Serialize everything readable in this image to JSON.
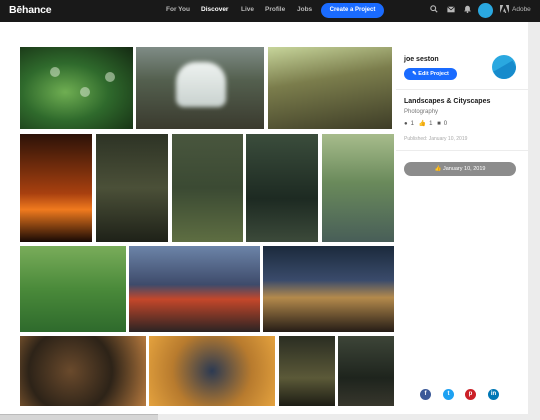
{
  "brand": {
    "logo": "Bēhance"
  },
  "nav": {
    "links": [
      "For You",
      "Discover",
      "Live",
      "Profile",
      "Jobs"
    ],
    "active": "Discover",
    "create_label": "Create a Project",
    "icons": [
      "search-icon",
      "mail-icon",
      "bell-icon"
    ],
    "adobe_label": "Adobe"
  },
  "sidebar": {
    "owner_name": "joe seston",
    "edit_label": "Edit Project",
    "project_title": "Landscapes & Cityscapes",
    "field": "Photography",
    "stats": {
      "views": "1",
      "appreciations": "1",
      "comments": "0"
    },
    "published": "Published: January 10, 2019",
    "appreciate_date": "January 10, 2019"
  },
  "social": [
    "facebook-icon",
    "twitter-icon",
    "pinterest-icon",
    "linkedin-icon"
  ],
  "colors": {
    "accent": "#1a6bff",
    "nav_bg": "#191919"
  }
}
